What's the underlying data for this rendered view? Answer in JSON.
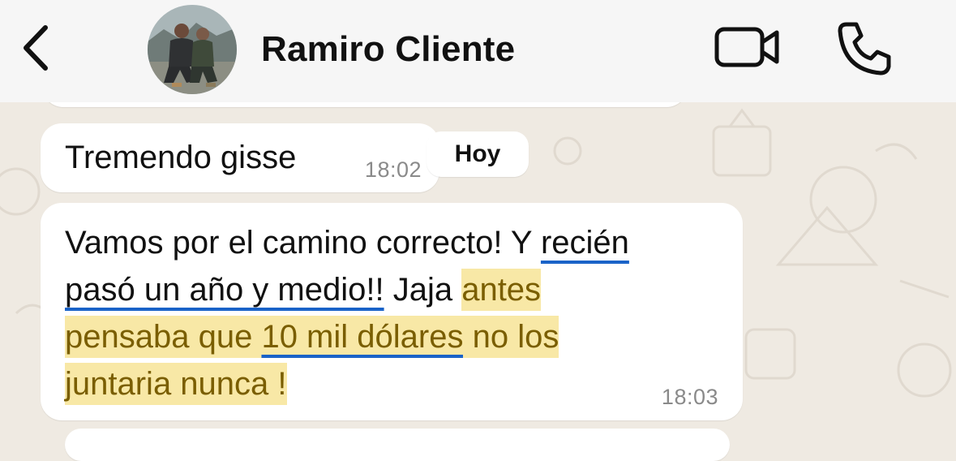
{
  "header": {
    "contact_name": "Ramiro Cliente",
    "back_icon": "chevron-left-icon",
    "video_icon": "video-camera-icon",
    "phone_icon": "phone-icon"
  },
  "messages": [
    {
      "text": "Tremendo gisse",
      "time": "18:02"
    },
    {
      "lines": [
        [
          "Vamos por el camino correcto! Y ",
          "recién"
        ],
        [
          "pasó un año y medio!!",
          " Jaja ",
          "antes"
        ],
        [
          "pensaba que ",
          "10 mil dólares",
          " no los"
        ],
        [
          "juntaria nunca !"
        ]
      ],
      "time": "18:03"
    }
  ],
  "day_chip": "Hoy",
  "colors": {
    "header_bg": "#f6f6f6",
    "chat_bg": "#efeae2",
    "bubble_bg": "#ffffff",
    "highlight": "#f8e8a6",
    "underline": "#1a63c8"
  }
}
